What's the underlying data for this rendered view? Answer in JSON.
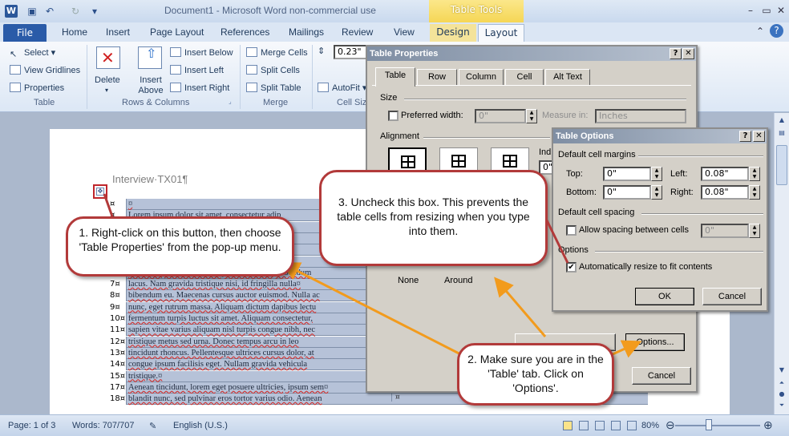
{
  "title_bar": {
    "doc_title": "Document1  -  Microsoft Word non-commercial use",
    "contextual_group": "Table Tools",
    "app_icon_letter": "W"
  },
  "tabs": [
    "File",
    "Home",
    "Insert",
    "Page Layout",
    "References",
    "Mailings",
    "Review",
    "View",
    "Design",
    "Layout"
  ],
  "ribbon": {
    "table_group": {
      "label": "Table",
      "items": [
        "Select",
        "View Gridlines",
        "Properties"
      ]
    },
    "delete_label": "Delete",
    "insert_above_label": "Insert Above",
    "insert_items": [
      "Insert Below",
      "Insert Left",
      "Insert Right"
    ],
    "rows_columns_label": "Rows & Columns",
    "merge_items": [
      "Merge Cells",
      "Split Cells",
      "Split Table"
    ],
    "merge_label": "Merge",
    "cell_height_value": "0.23\"",
    "autofit_label": "AutoFit",
    "cell_size_label": "Cell Siz"
  },
  "document": {
    "heading": "Interview·TX01¶",
    "rows": [
      {
        "num": "¤",
        "text": "¤"
      },
      {
        "num": "¤",
        "text": "Lorem ipsum dolor sit amet, consectetur adip"
      },
      {
        "num": "",
        "text": ""
      },
      {
        "num": "",
        "text": ""
      },
      {
        "num": "",
        "text": ""
      },
      {
        "num": "",
        "text": ""
      },
      {
        "num": "",
        "text": "lacus odio, malesuada et imperdiet sit amet, bibendum"
      },
      {
        "num": "7¤",
        "text": "lacus. Nam gravida tristique nisi, id fringilla nulla¤"
      },
      {
        "num": "8¤",
        "text": "bibendum eu. Maecenas cursus auctor euismod. Nulla ac"
      },
      {
        "num": "9¤",
        "text": "nunc, eget rutrum massa. Aliquam dictum dapibus lectu"
      },
      {
        "num": "10¤",
        "text": "fermentum turpis luctus sit amet. Aliquam consectetur,"
      },
      {
        "num": "11¤",
        "text": "sapien vitae varius aliquam nisl turpis congue nibh, nec"
      },
      {
        "num": "12¤",
        "text": "tristique metus sed urna. Donec tempus arcu in leo"
      },
      {
        "num": "13¤",
        "text": "tincidunt rhoncus. Pellentesque ultrices cursus dolor, at"
      },
      {
        "num": "14¤",
        "text": "congue ipsum facilisis eget. Nullam gravida vehicula"
      },
      {
        "num": "15¤",
        "text": "tristique.¤"
      },
      {
        "num": "17¤",
        "text": "Aenean tincidunt, lorem eget posuere ultricies, ipsum sem¤"
      },
      {
        "num": "18¤",
        "text": "blandit nunc, sed pulvinar eros tortor varius odio. Aenean"
      }
    ]
  },
  "table_properties": {
    "title": "Table Properties",
    "tabs": [
      "Table",
      "Row",
      "Column",
      "Cell",
      "Alt Text"
    ],
    "size_label": "Size",
    "preferred_width_label": "Preferred width:",
    "preferred_width_value": "0\"",
    "measure_in_label": "Measure in:",
    "measure_in_value": "Inches",
    "alignment_label": "Alignment",
    "indent_label": "Ind",
    "indent_value": "0\"",
    "wrap_none": "None",
    "wrap_around": "Around",
    "options_button": "Options...",
    "cancel_button": "Cancel"
  },
  "table_options": {
    "title": "Table Options",
    "margins_label": "Default cell margins",
    "top_label": "Top:",
    "top_value": "0\"",
    "left_label": "Left:",
    "left_value": "0.08\"",
    "bottom_label": "Bottom:",
    "bottom_value": "0\"",
    "right_label": "Right:",
    "right_value": "0.08\"",
    "spacing_label": "Default cell spacing",
    "allow_spacing_label": "Allow spacing between cells",
    "spacing_value": "0\"",
    "options_label": "Options",
    "autoresize_label": "Automatically resize to fit contents",
    "autoresize_checked": "✔",
    "ok_button": "OK",
    "cancel_button": "Cancel"
  },
  "callouts": {
    "c1": "1. Right-click on this button, then choose 'Table Properties' from the pop-up menu.",
    "c2": "2. Make sure you are in the 'Table' tab. Click on 'Options'.",
    "c3": "3. Uncheck this box. This prevents the table cells from resizing when you type into them."
  },
  "status_bar": {
    "page": "Page: 1 of 3",
    "words": "Words: 707/707",
    "language": "English (U.S.)",
    "zoom": "80%"
  },
  "colors": {
    "callout_border": "#b23a3a",
    "arrow": "#f29b1d",
    "file_tab": "#2a5ba8",
    "table_tools": "#f5d655"
  }
}
